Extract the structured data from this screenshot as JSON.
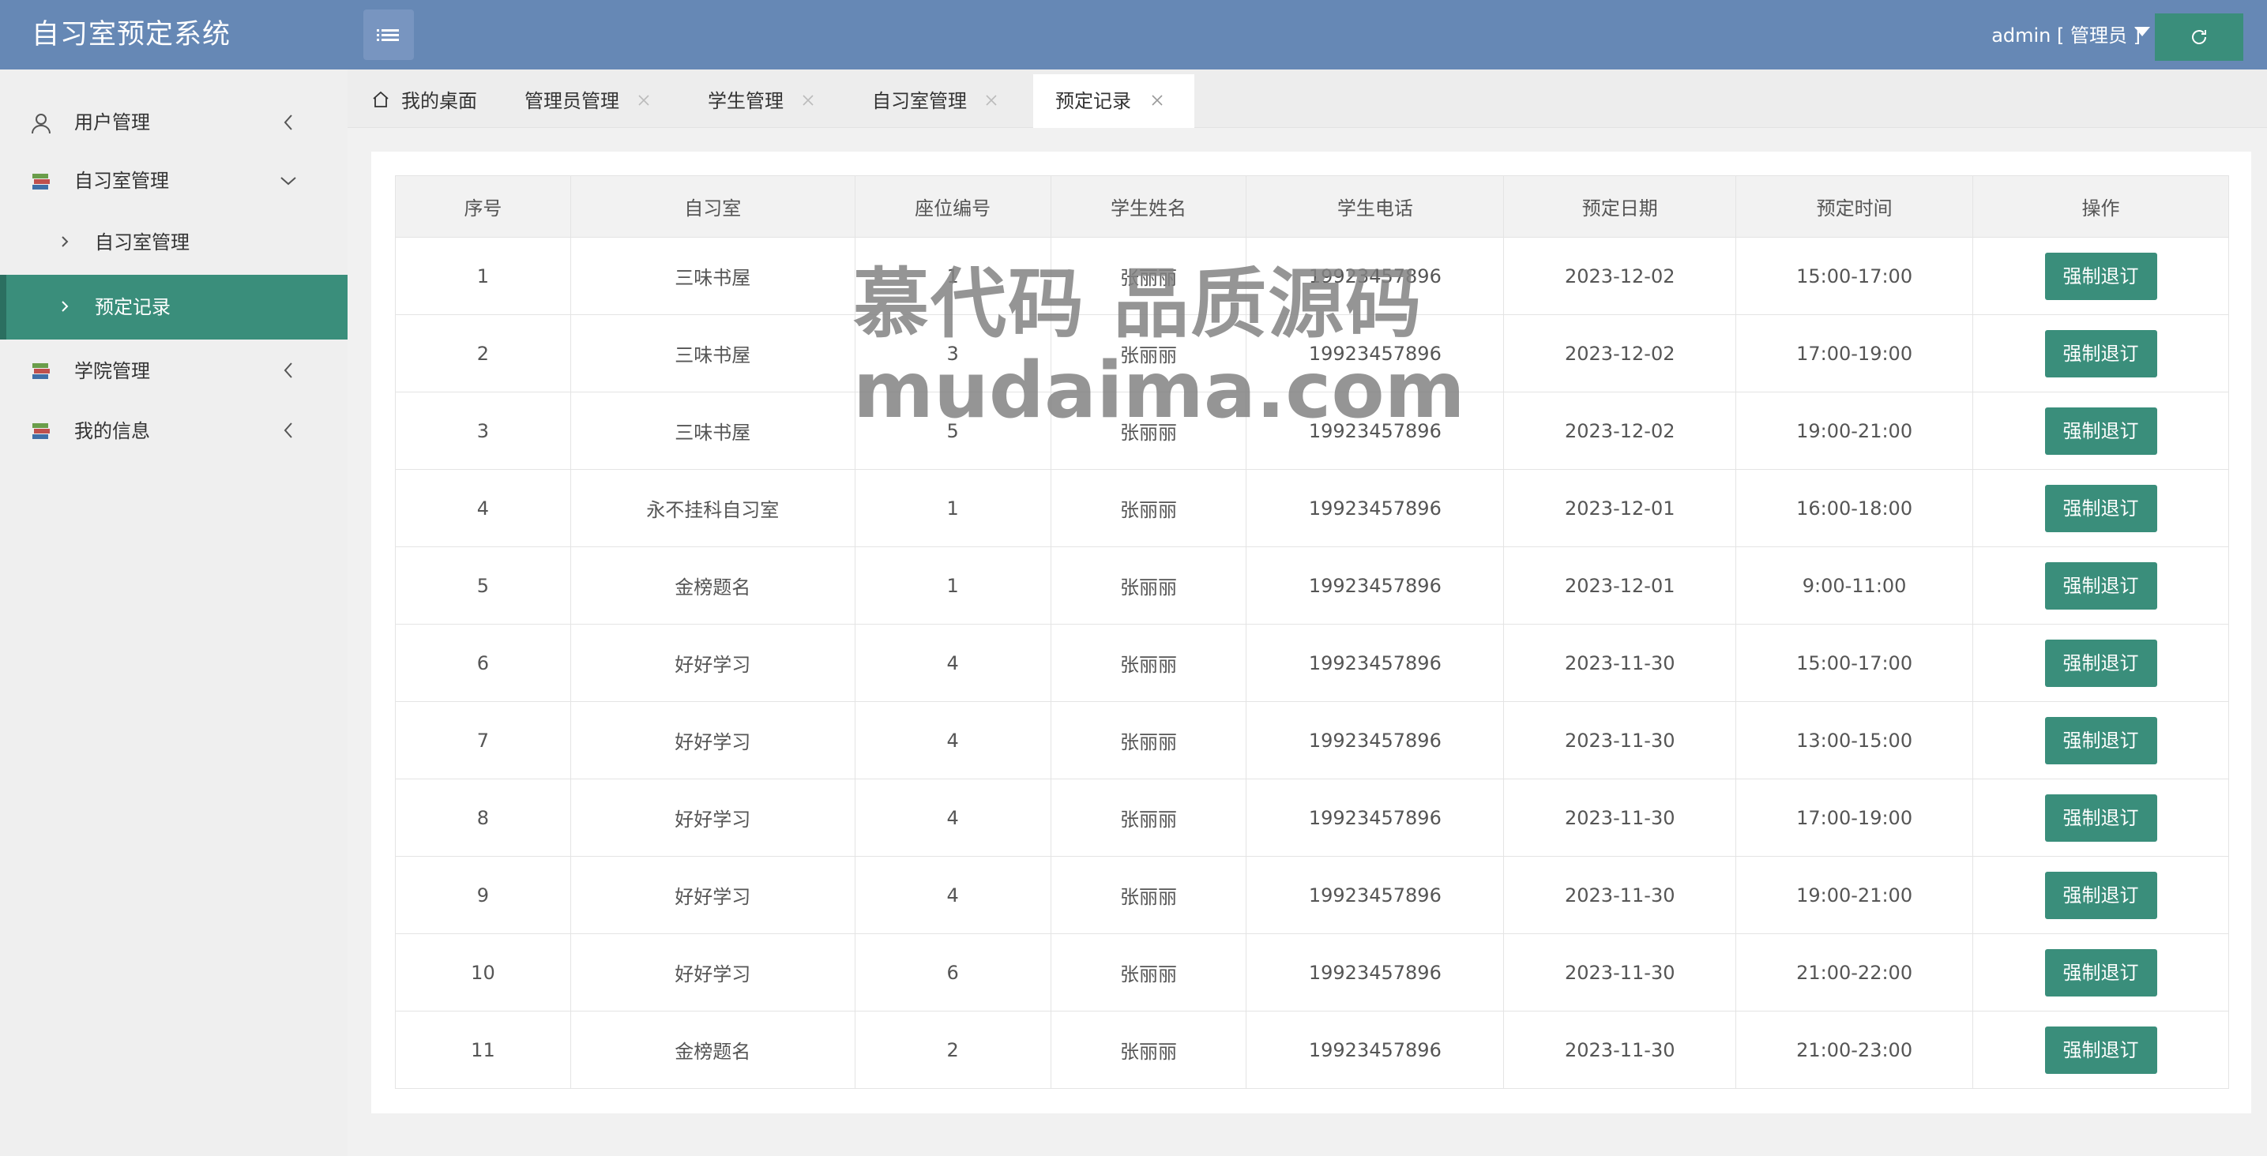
{
  "app": {
    "title": "自习室预定系统"
  },
  "header": {
    "user_label": "admin [ 管理员 ]",
    "refresh_icon": "refresh-icon",
    "menu_icon": "list-icon"
  },
  "sidebar": {
    "items": [
      {
        "label": "用户管理",
        "icon": "user-icon",
        "expanded": false
      },
      {
        "label": "自习室管理",
        "icon": "books-icon",
        "expanded": true,
        "children": [
          {
            "label": "自习室管理",
            "active": false
          },
          {
            "label": "预定记录",
            "active": true
          }
        ]
      },
      {
        "label": "学院管理",
        "icon": "books-icon",
        "expanded": false
      },
      {
        "label": "我的信息",
        "icon": "books-icon",
        "expanded": false
      }
    ]
  },
  "tabs": [
    {
      "label": "我的桌面",
      "icon": "home-icon",
      "closable": false
    },
    {
      "label": "管理员管理",
      "closable": true
    },
    {
      "label": "学生管理",
      "closable": true
    },
    {
      "label": "自习室管理",
      "closable": true
    },
    {
      "label": "预定记录",
      "closable": true,
      "active": true
    }
  ],
  "table": {
    "headers": [
      "序号",
      "自习室",
      "座位编号",
      "学生姓名",
      "学生电话",
      "预定日期",
      "预定时间",
      "操作"
    ],
    "action_label": "强制退订",
    "rows": [
      [
        "1",
        "三味书屋",
        "1",
        "张丽丽",
        "19923457896",
        "2023-12-02",
        "15:00-17:00"
      ],
      [
        "2",
        "三味书屋",
        "3",
        "张丽丽",
        "19923457896",
        "2023-12-02",
        "17:00-19:00"
      ],
      [
        "3",
        "三味书屋",
        "5",
        "张丽丽",
        "19923457896",
        "2023-12-02",
        "19:00-21:00"
      ],
      [
        "4",
        "永不挂科自习室",
        "1",
        "张丽丽",
        "19923457896",
        "2023-12-01",
        "16:00-18:00"
      ],
      [
        "5",
        "金榜题名",
        "1",
        "张丽丽",
        "19923457896",
        "2023-12-01",
        "9:00-11:00"
      ],
      [
        "6",
        "好好学习",
        "4",
        "张丽丽",
        "19923457896",
        "2023-11-30",
        "15:00-17:00"
      ],
      [
        "7",
        "好好学习",
        "4",
        "张丽丽",
        "19923457896",
        "2023-11-30",
        "13:00-15:00"
      ],
      [
        "8",
        "好好学习",
        "4",
        "张丽丽",
        "19923457896",
        "2023-11-30",
        "17:00-19:00"
      ],
      [
        "9",
        "好好学习",
        "4",
        "张丽丽",
        "19923457896",
        "2023-11-30",
        "19:00-21:00"
      ],
      [
        "10",
        "好好学习",
        "6",
        "张丽丽",
        "19923457896",
        "2023-11-30",
        "21:00-22:00"
      ],
      [
        "11",
        "金榜题名",
        "2",
        "张丽丽",
        "19923457896",
        "2023-11-30",
        "21:00-23:00"
      ]
    ]
  },
  "watermark": {
    "line1": "慕代码 品质源码",
    "line2": "mudaima.com"
  },
  "colors": {
    "header": "#6688b5",
    "accent": "#3a8e7b",
    "sidebar": "#efefef"
  }
}
